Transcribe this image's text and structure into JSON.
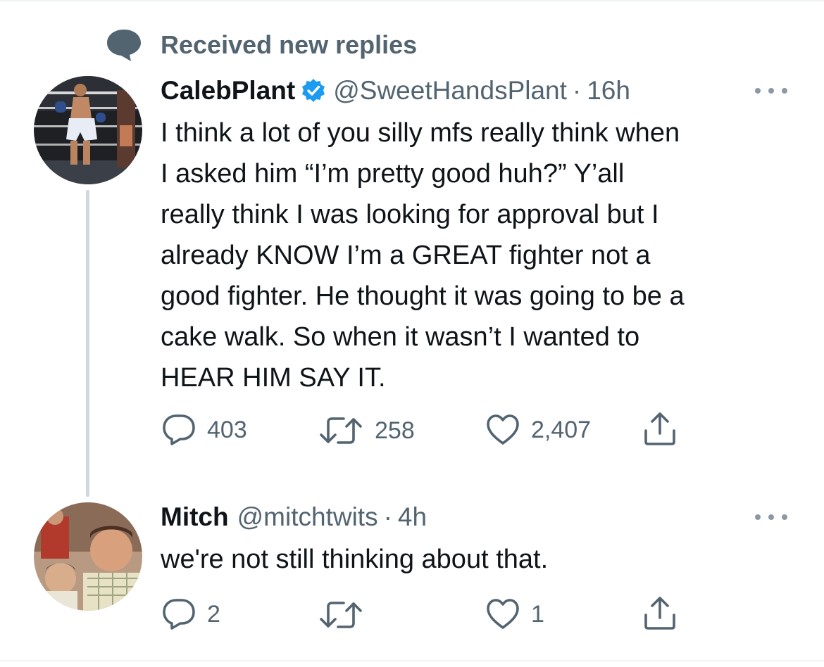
{
  "context": {
    "icon": "speech-bubble-icon",
    "label": "Received new replies"
  },
  "tweets": [
    {
      "name": "CalebPlant",
      "verified": true,
      "handle": "@SweetHandsPlant",
      "separator": "·",
      "time": "16h",
      "lines": [
        "I think a lot of you silly mfs really think when",
        "I asked him “I’m pretty good huh?” Y’all",
        "really think I was looking for approval but I",
        "already KNOW I’m a GREAT fighter not a",
        "good fighter. He thought it was going to be a",
        "cake walk. So when it wasn’t I wanted to",
        "HEAR HIM SAY IT."
      ],
      "replies": "403",
      "retweets": "258",
      "likes": "2,407"
    },
    {
      "name": "Mitch",
      "verified": false,
      "handle": "@mitchtwits",
      "separator": "·",
      "time": "4h",
      "lines": [
        "we're not still thinking about that."
      ],
      "replies": "2",
      "retweets": "",
      "likes": "1"
    }
  ],
  "colors": {
    "text": "#0f1419",
    "secondary": "#536471",
    "verified": "#1d9bf0",
    "thread_line": "#cfd9de"
  },
  "icons": {
    "reply": "reply-icon",
    "retweet": "retweet-icon",
    "like": "heart-icon",
    "share": "share-icon",
    "more": "more-icon",
    "verified": "verified-badge-icon"
  }
}
